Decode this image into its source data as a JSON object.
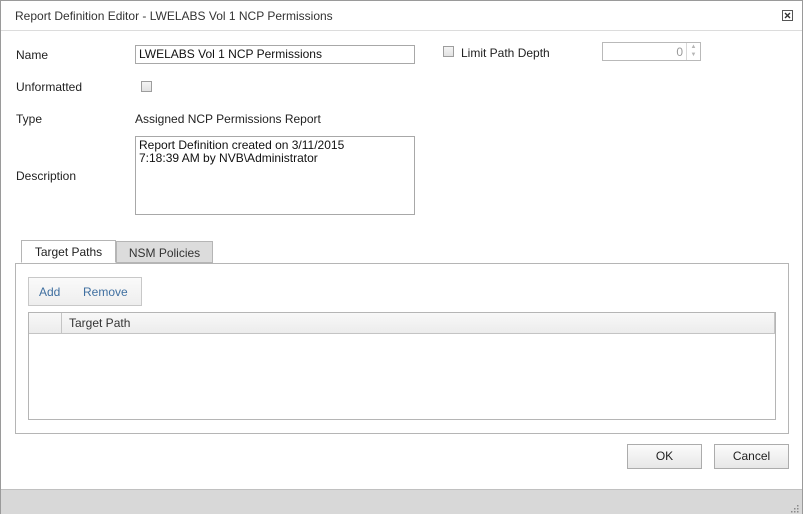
{
  "window": {
    "title": "Report Definition Editor - LWELABS Vol 1 NCP Permissions"
  },
  "form": {
    "name_label": "Name",
    "name_value": "LWELABS Vol 1 NCP Permissions",
    "unformatted_label": "Unformatted",
    "unformatted_checked": false,
    "type_label": "Type",
    "type_value": "Assigned NCP Permissions Report",
    "description_label": "Description",
    "description_value": "Report Definition created on 3/11/2015\n7:18:39 AM by NVB\\Administrator",
    "limit_path_depth_label": "Limit Path Depth",
    "limit_path_depth_checked": false,
    "limit_path_depth_value": "0"
  },
  "tabs": [
    {
      "label": "Target Paths",
      "active": true
    },
    {
      "label": "NSM Policies",
      "active": false
    }
  ],
  "toolbar": {
    "add_label": "Add",
    "remove_label": "Remove"
  },
  "grid": {
    "columns": [
      "Target Path"
    ],
    "rows": []
  },
  "buttons": {
    "ok_label": "OK",
    "cancel_label": "Cancel"
  },
  "icons": {
    "close": "close-icon",
    "resize": "resize-grip-icon"
  }
}
